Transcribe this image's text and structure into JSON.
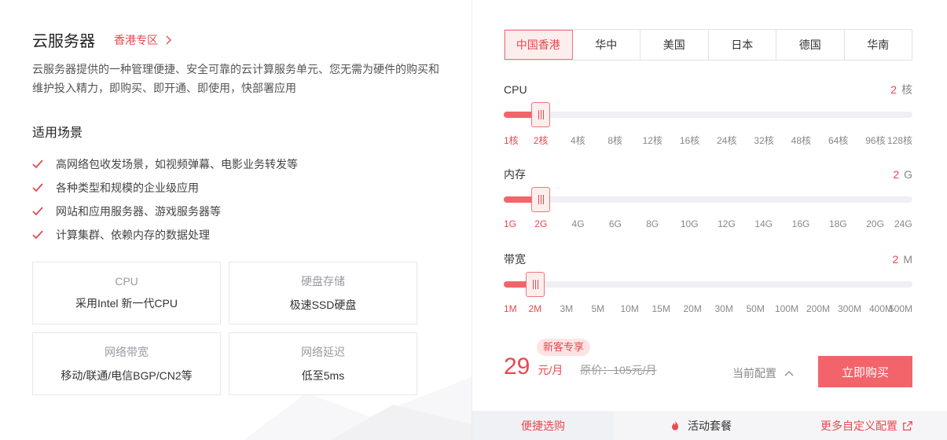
{
  "product": {
    "title": "云服务器",
    "region_link": "香港专区",
    "description": "云服务器提供的一种管理便捷、安全可靠的云计算服务单元、您无需为硬件的购买和维护投入精力，即购买、即开通、即使用，快部署应用"
  },
  "scenarios": {
    "title": "适用场景",
    "items": [
      "高网络包收发场景，如视频弹幕、电影业务转发等",
      "各种类型和规模的企业级应用",
      "网站和应用服务器、游戏服务器等",
      "计算集群、依赖内存的数据处理"
    ]
  },
  "features": [
    {
      "label": "CPU",
      "value": "采用Intel 新一代CPU"
    },
    {
      "label": "硬盘存储",
      "value": "极速SSD硬盘"
    },
    {
      "label": "网络带宽",
      "value": "移动/联通/电信BGP/CN2等"
    },
    {
      "label": "网络延迟",
      "value": "低至5ms"
    }
  ],
  "regions": {
    "tabs": [
      "中国香港",
      "华中",
      "美国",
      "日本",
      "德国",
      "华南"
    ],
    "active_index": 0
  },
  "sliders": {
    "cpu": {
      "label": "CPU",
      "value": "2",
      "unit": "核",
      "ticks": [
        "1核",
        "2核",
        "4核",
        "8核",
        "12核",
        "16核",
        "24核",
        "32核",
        "48核",
        "64核",
        "96核",
        "128核"
      ],
      "selected_index": 1
    },
    "memory": {
      "label": "内存",
      "value": "2",
      "unit": "G",
      "ticks": [
        "1G",
        "2G",
        "4G",
        "6G",
        "8G",
        "10G",
        "12G",
        "14G",
        "16G",
        "18G",
        "20G",
        "24G"
      ],
      "selected_index": 1
    },
    "bandwidth": {
      "label": "带宽",
      "value": "2",
      "unit": "M",
      "ticks": [
        "1M",
        "2M",
        "3M",
        "5M",
        "10M",
        "15M",
        "20M",
        "30M",
        "50M",
        "100M",
        "200M",
        "300M",
        "400M",
        "500M"
      ],
      "selected_index": 1
    }
  },
  "pricing": {
    "badge": "新客专享",
    "price": "29",
    "unit": "元/月",
    "original": "原价：105元/月",
    "current_config": "当前配置",
    "buy_label": "立即购买"
  },
  "bottom_tabs": {
    "quick": "便捷选购",
    "activity": "活动套餐",
    "custom": "更多自定义配置"
  },
  "colors": {
    "accent": "#e8484f",
    "accent_light": "#fdeeee",
    "button": "#f2646a"
  }
}
